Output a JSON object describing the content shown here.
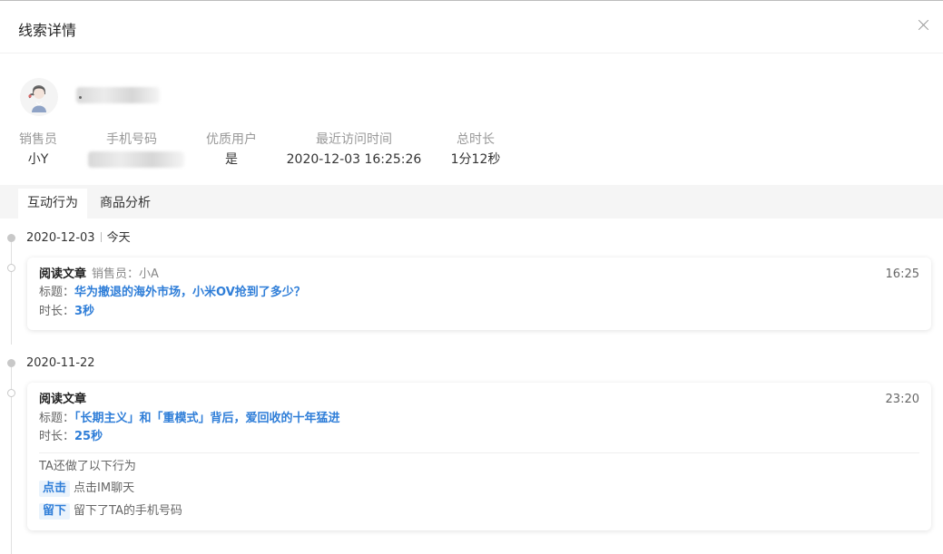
{
  "header": {
    "title": "线索详情",
    "close_icon": "close-icon"
  },
  "profile": {
    "avatar_icon": "user-avatar-icon"
  },
  "info": [
    {
      "label": "销售员",
      "value": "小Y"
    },
    {
      "label": "手机号码",
      "value": ""
    },
    {
      "label": "优质用户",
      "value": "是"
    },
    {
      "label": "最近访问时间",
      "value": "2020-12-03 16:25:26"
    },
    {
      "label": "总时长",
      "value": "1分12秒"
    }
  ],
  "tabs": [
    {
      "label": "互动行为",
      "active": true
    },
    {
      "label": "商品分析",
      "active": false
    }
  ],
  "timeline": [
    {
      "date": "2020-12-03",
      "date_tag": "今天",
      "card": {
        "type": "阅读文章",
        "seller": "销售员：小A",
        "time": "16:25",
        "title_label": "标题：",
        "title": "华为撤退的海外市场，小米OV抢到了多少？",
        "duration_label": "时长：",
        "duration": "3秒"
      }
    },
    {
      "date": "2020-11-22",
      "card": {
        "type": "阅读文章",
        "time": "23:20",
        "title_label": "标题：",
        "title": "「长期主义」和「重模式」背后，爱回收的十年猛进",
        "duration_label": "时长：",
        "duration": "25秒",
        "extra_heading": "TA还做了以下行为",
        "extra_actions": [
          {
            "tag": "点击",
            "text": "点击IM聊天"
          },
          {
            "tag": "留下",
            "text": "留下了TA的手机号码"
          }
        ]
      }
    }
  ],
  "colors": {
    "accent": "#2f7ed8",
    "tab_bg": "#f5f5f5",
    "muted": "#999999"
  }
}
